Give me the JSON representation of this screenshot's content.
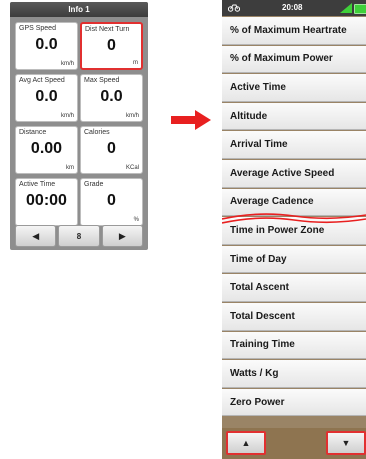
{
  "left_screen": {
    "title": "Info 1",
    "fields": [
      {
        "label": "GPS Speed",
        "value": "0.0",
        "unit": "km/h",
        "highlight": false
      },
      {
        "label": "Dist Next Turn",
        "value": "0",
        "unit": "m",
        "highlight": true
      },
      {
        "label": "Avg Act Speed",
        "value": "0.0",
        "unit": "km/h",
        "highlight": false
      },
      {
        "label": "Max Speed",
        "value": "0.0",
        "unit": "km/h",
        "highlight": false
      },
      {
        "label": "Distance",
        "value": "0.00",
        "unit": "km",
        "highlight": false
      },
      {
        "label": "Calories",
        "value": "0",
        "unit": "KCal",
        "highlight": false
      },
      {
        "label": "Active Time",
        "value": "00:00",
        "unit": "",
        "highlight": false
      },
      {
        "label": "Grade",
        "value": "0",
        "unit": "%",
        "highlight": false
      }
    ],
    "nav": {
      "prev_icon": "◀",
      "page": "8",
      "next_icon": "▶"
    }
  },
  "arrow_color": "#e82020",
  "right_screen": {
    "status": {
      "bike_icon": "bike-icon",
      "time": "20:08"
    },
    "items": [
      "% of Maximum Heartrate",
      "% of Maximum Power",
      "Active Time",
      "Altitude",
      "Arrival Time",
      "Average Active Speed",
      "Average Cadence",
      "Time in Power Zone",
      "Time of Day",
      "Total Ascent",
      "Total Descent",
      "Training Time",
      "Watts / Kg",
      "Zero Power"
    ],
    "scroll": {
      "up_icon": "▲",
      "down_icon": "▼"
    }
  }
}
